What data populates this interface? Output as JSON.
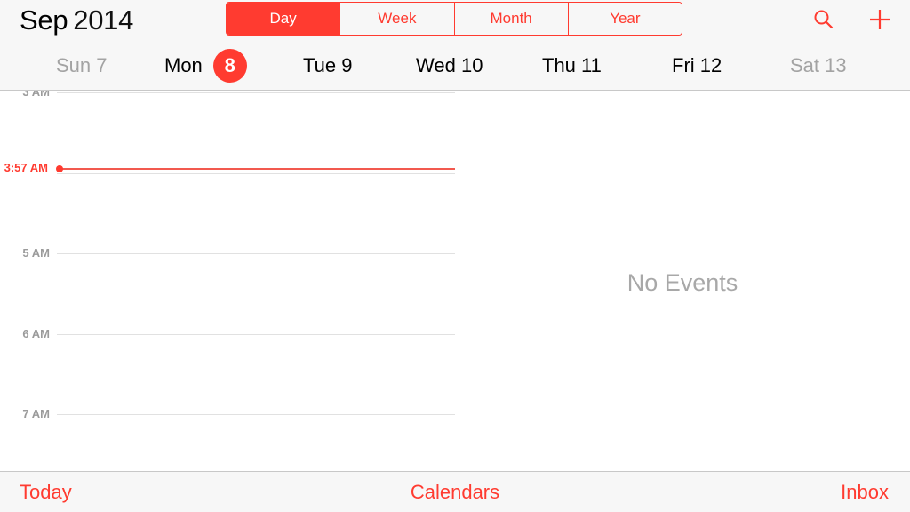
{
  "header": {
    "month": "Sep",
    "year": "2014",
    "view_tabs": [
      {
        "label": "Day",
        "active": true
      },
      {
        "label": "Week",
        "active": false
      },
      {
        "label": "Month",
        "active": false
      },
      {
        "label": "Year",
        "active": false
      }
    ],
    "icons": {
      "search": "search-icon",
      "add": "plus-icon"
    }
  },
  "week": {
    "days": [
      {
        "weekday": "Sun",
        "date": "7",
        "weekend": true,
        "selected": false
      },
      {
        "weekday": "Mon",
        "date": "8",
        "weekend": false,
        "selected": true
      },
      {
        "weekday": "Tue",
        "date": "9",
        "weekend": false,
        "selected": false
      },
      {
        "weekday": "Wed",
        "date": "10",
        "weekend": false,
        "selected": false
      },
      {
        "weekday": "Thu",
        "date": "11",
        "weekend": false,
        "selected": false
      },
      {
        "weekday": "Fri",
        "date": "12",
        "weekend": false,
        "selected": false
      },
      {
        "weekday": "Sat",
        "date": "13",
        "weekend": true,
        "selected": false
      }
    ]
  },
  "timeline": {
    "hours": [
      {
        "label": "3 AM",
        "hour": 3
      },
      {
        "label": "",
        "hour": 4
      },
      {
        "label": "5 AM",
        "hour": 5
      },
      {
        "label": "6 AM",
        "hour": 6
      },
      {
        "label": "7 AM",
        "hour": 7
      }
    ],
    "current_time": {
      "label": "3:57 AM",
      "hour": 3.95
    }
  },
  "detail": {
    "empty_message": "No Events"
  },
  "toolbar": {
    "today_label": "Today",
    "calendars_label": "Calendars",
    "inbox_label": "Inbox"
  },
  "colors": {
    "accent": "#ff3b30",
    "muted_text": "#a3a3a3",
    "bar_background": "#f7f7f7"
  }
}
